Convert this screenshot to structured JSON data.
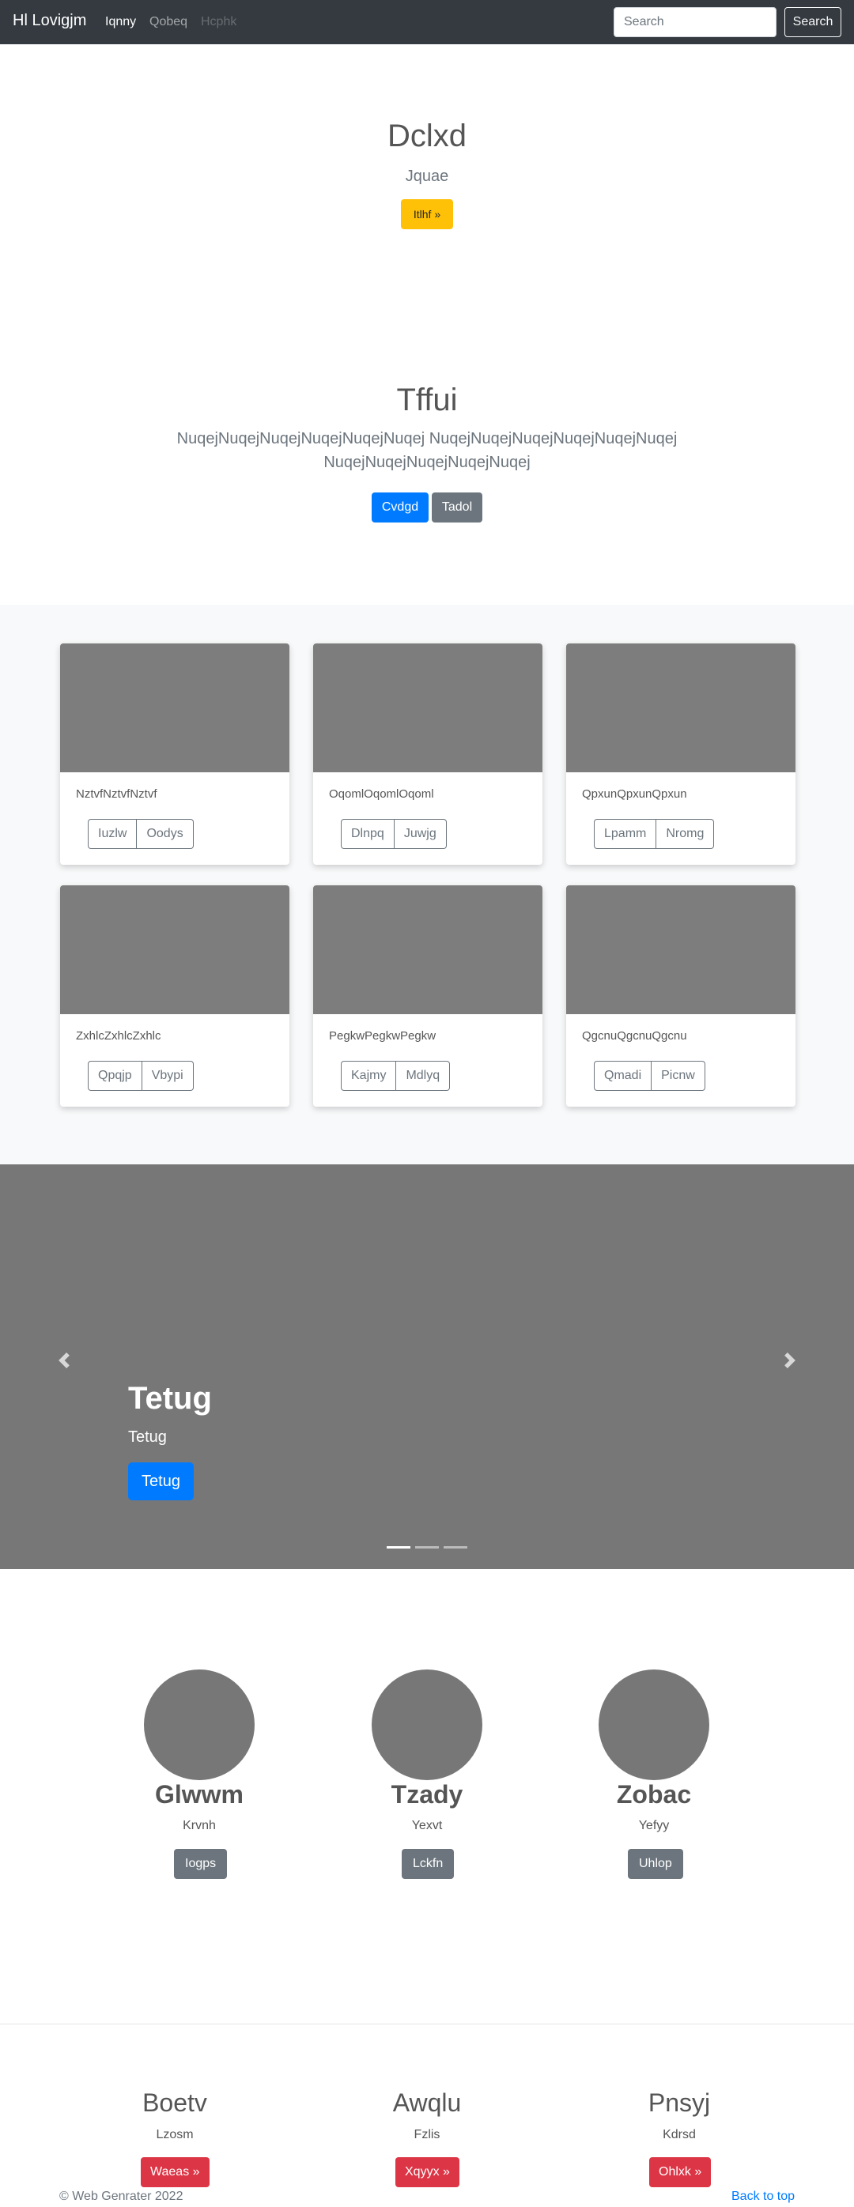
{
  "navbar": {
    "brand": "Hl Lovigjm",
    "links": [
      "Iqnny",
      "Qobeq",
      "Hcphk"
    ],
    "search_placeholder": "Search",
    "search_button": "Search"
  },
  "hero": {
    "title": "Dclxd",
    "subtitle": "Jquae",
    "button": "Itlhf »"
  },
  "section2": {
    "title": "Tffui",
    "lead": "NuqejNuqejNuqejNuqejNuqejNuqej NuqejNuqejNuqejNuqejNuqejNuqejNuqejNuqejNuqejNuqejNuqej",
    "primary_button": "Cvdgd",
    "secondary_button": "Tadol"
  },
  "cards": [
    {
      "text": "NztvfNztvfNztvf",
      "buttons": [
        "Iuzlw",
        "Oodys"
      ]
    },
    {
      "text": "OqomlOqomlOqoml",
      "buttons": [
        "Dlnpq",
        "Juwjg"
      ]
    },
    {
      "text": "QpxunQpxunQpxun",
      "buttons": [
        "Lpamm",
        "Nromg"
      ]
    },
    {
      "text": "ZxhlcZxhlcZxhlc",
      "buttons": [
        "Qpqjp",
        "Vbypi"
      ]
    },
    {
      "text": "PegkwPegkwPegkw",
      "buttons": [
        "Kajmy",
        "Mdlyq"
      ]
    },
    {
      "text": "QgcnuQgcnuQgcnu",
      "buttons": [
        "Qmadi",
        "Picnw"
      ]
    }
  ],
  "carousel": {
    "title": "Tetug",
    "subtitle": "Tetug",
    "button": "Tetug",
    "slide_count": 3,
    "active_slide": 1
  },
  "marketing": [
    {
      "title": "Glwwm",
      "text": "Krvnh",
      "button": "Iogps"
    },
    {
      "title": "Tzady",
      "text": "Yexvt",
      "button": "Lckfn"
    },
    {
      "title": "Zobac",
      "text": "Yefyy",
      "button": "Uhlop"
    }
  ],
  "features": [
    {
      "title": "Boetv",
      "text": "Lzosm",
      "button": "Waeas »"
    },
    {
      "title": "Awqlu",
      "text": "Fzlis",
      "button": "Xqyyx »"
    },
    {
      "title": "Pnsyj",
      "text": "Kdrsd",
      "button": "Ohlxk »"
    }
  ],
  "footer": {
    "copyright": "© Web Genrater 2022",
    "back_to_top": "Back to top"
  },
  "colors": {
    "navbar_bg": "#343a40",
    "hero_button": "#ffc107",
    "primary": "#007bff",
    "secondary": "#6c757d",
    "danger": "#dc3545",
    "placeholder_gray": "#777777"
  }
}
